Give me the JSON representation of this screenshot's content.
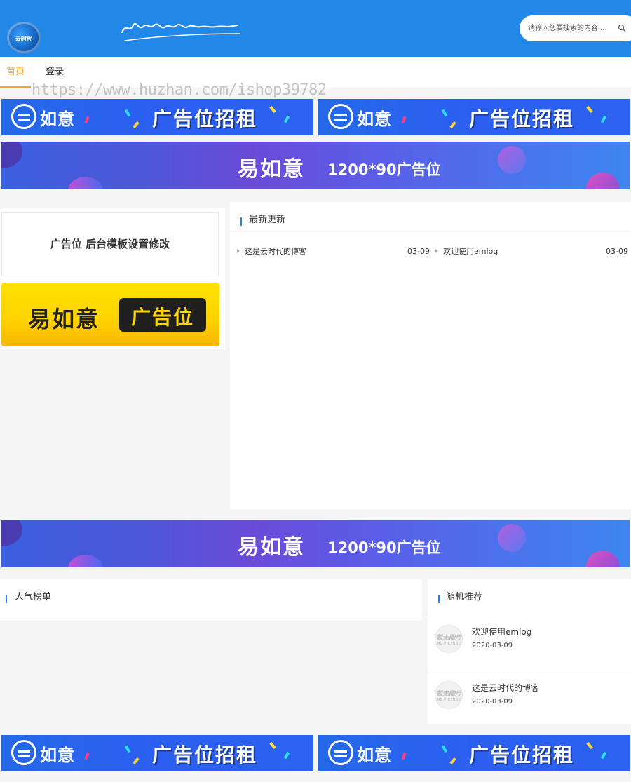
{
  "header": {
    "logo_text": "云时代",
    "search_placeholder": "请输入您要搜索的内容..."
  },
  "nav": {
    "items": [
      {
        "label": "首页",
        "active": true
      },
      {
        "label": "登录",
        "active": false
      }
    ]
  },
  "watermark": "https://www.huzhan.com/ishop39782",
  "ads": {
    "half_brand": "如意",
    "half_title": "广告位招租",
    "wide_brand": "易如意",
    "wide_size": "1200*90广告位",
    "text_ad": "广告位 后台模板设置修改",
    "yellow_brand": "易如意",
    "yellow_badge": "广告位"
  },
  "latest": {
    "title": "最新更新",
    "items": [
      {
        "title": "这是云时代的博客",
        "date": "03-09"
      },
      {
        "title": "欢迎使用emlog",
        "date": "03-09"
      }
    ]
  },
  "popular": {
    "title": "人气榜单"
  },
  "random": {
    "title": "随机推荐",
    "thumb_label": "暂无图片",
    "thumb_sub": "NO PICTURE",
    "items": [
      {
        "title": "欢迎使用emlog",
        "date": "2020-03-09"
      },
      {
        "title": "这是云时代的博客",
        "date": "2020-03-09"
      }
    ]
  },
  "colors": {
    "header_bg": "#2188e8",
    "nav_active": "#f5a623",
    "accent_bar": "#2a7ee8"
  }
}
